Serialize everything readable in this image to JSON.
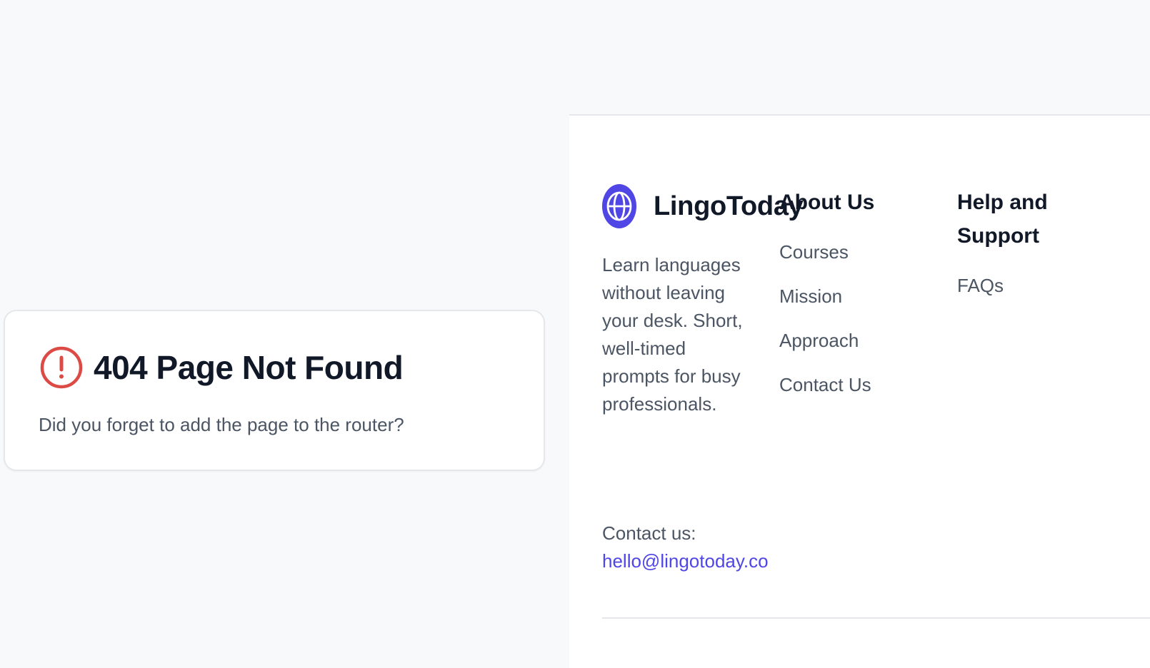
{
  "colors": {
    "page_background": "#f8f9fb",
    "card_background": "#ffffff",
    "border": "#e5e7eb",
    "alert_red": "#dc4a45",
    "heading_text": "#111827",
    "body_text": "#4b5563",
    "brand_accent": "#4f46e5"
  },
  "not_found": {
    "icon": "alert-circle-icon",
    "title": "404 Page Not Found",
    "message": "Did you forget to add the page to the router?"
  },
  "footer": {
    "brand": {
      "logo_icon": "globe-icon",
      "name": "LingoToday"
    },
    "tagline": "Learn languages without leaving your desk. Short, well-timed prompts for busy professionals.",
    "contact_label": "Contact us:",
    "contact_email": "hello@lingotoday.co",
    "columns": [
      {
        "heading": "About Us",
        "links": [
          "Courses",
          "Mission",
          "Approach",
          "Contact Us"
        ]
      },
      {
        "heading": "Help and Support",
        "links": [
          "FAQs"
        ]
      }
    ]
  }
}
